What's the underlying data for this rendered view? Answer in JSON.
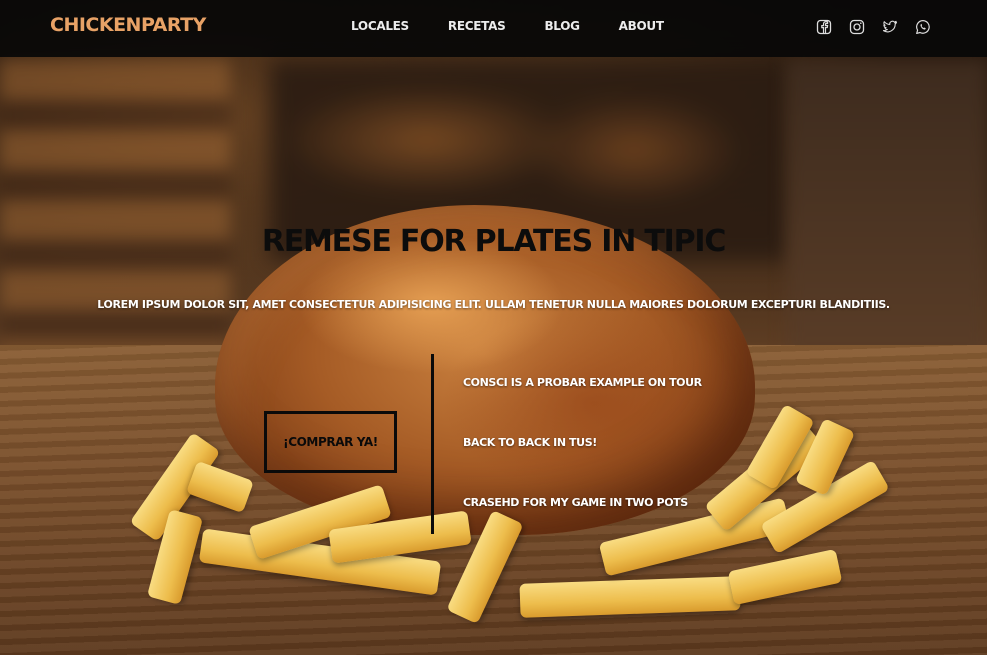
{
  "brand": "CHICKENPARTY",
  "nav": {
    "links": [
      "LOCALES",
      "RECETAS",
      "BLOG",
      "ABOUT"
    ]
  },
  "socials": [
    {
      "icon": "facebook-icon"
    },
    {
      "icon": "instagram-icon"
    },
    {
      "icon": "twitter-icon"
    },
    {
      "icon": "whatsapp-icon"
    }
  ],
  "hero": {
    "title": "REMESE FOR PLATES IN TIPIC",
    "subtitle": "LOREM IPSUM DOLOR SIT, AMET CONSECTETUR ADIPISICING ELIT. ULLAM TENETUR NULLA MAIORES DOLORUM EXCEPTURI BLANDITIIS.",
    "cta_label": "¡COMPRAR YA!",
    "features": [
      "CONSCI IS A PROBAR EXAMPLE ON TOUR",
      "BACK TO BACK IN TUS!",
      "CRASEHD FOR MY GAME IN TWO POTS"
    ]
  },
  "colors": {
    "brand": "#e8a266",
    "nav_bg": "#080808",
    "title": "#0c0c0c",
    "text_light": "#ffffff"
  }
}
